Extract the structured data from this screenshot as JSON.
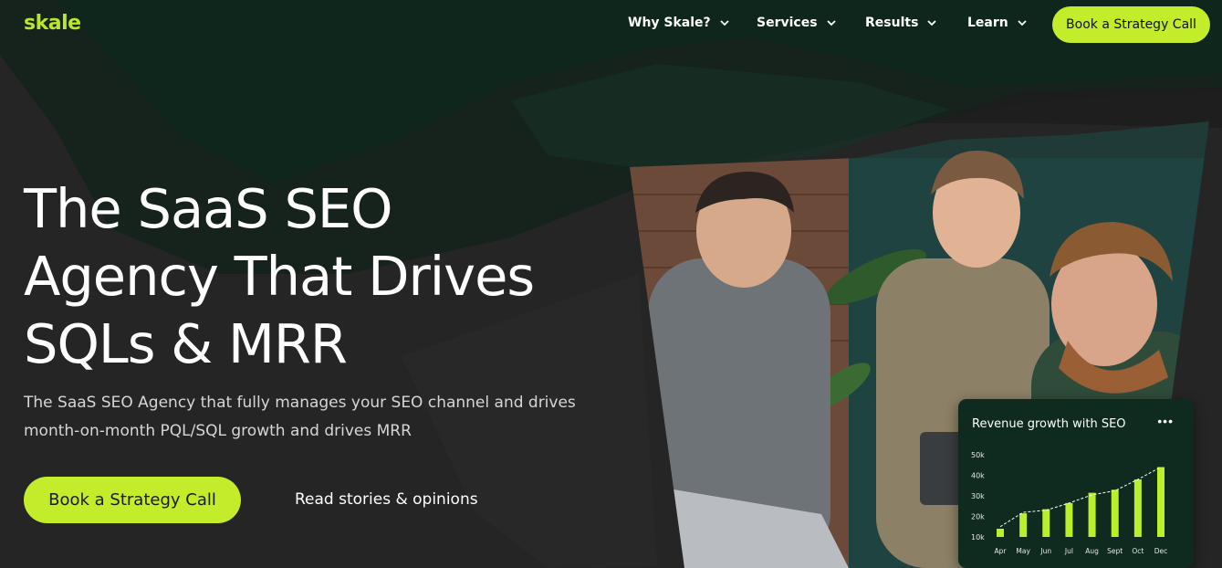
{
  "brand": {
    "logo_text": "skale",
    "accent": "#c3ec2b"
  },
  "nav": {
    "items": [
      {
        "label": "Why Skale?"
      },
      {
        "label": "Services"
      },
      {
        "label": "Results"
      },
      {
        "label": "Learn"
      }
    ],
    "cta_label": "Book a Strategy Call"
  },
  "hero": {
    "title_lines": [
      "The SaaS SEO",
      "Agency That Drives",
      "SQLs & MRR"
    ],
    "subtitle_lines": [
      "The SaaS SEO Agency that fully manages your SEO channel and drives",
      "month-on-month PQL/SQL growth and drives MRR"
    ],
    "cta_label": "Book a Strategy Call",
    "secondary_link": "Read stories & opinions"
  },
  "chart_data": {
    "type": "bar",
    "title": "Revenue growth with SEO",
    "menu_icon": "more-horizontal-icon",
    "categories": [
      "Apr",
      "May",
      "Jun",
      "Jul",
      "Aug",
      "Sept",
      "Oct",
      "Dec"
    ],
    "values": [
      14,
      21.5,
      23.5,
      26.5,
      31.5,
      33,
      38,
      44
    ],
    "trend": [
      15,
      22,
      23,
      26.5,
      30.5,
      32.5,
      38,
      44
    ],
    "y_ticks": [
      "50k",
      "40k",
      "30k",
      "20k",
      "10k"
    ],
    "y_tick_values": [
      50,
      40,
      30,
      20,
      10
    ],
    "ylim": [
      10,
      50
    ],
    "bar_color": "#b9f02a",
    "line_color": "#ffffff"
  }
}
